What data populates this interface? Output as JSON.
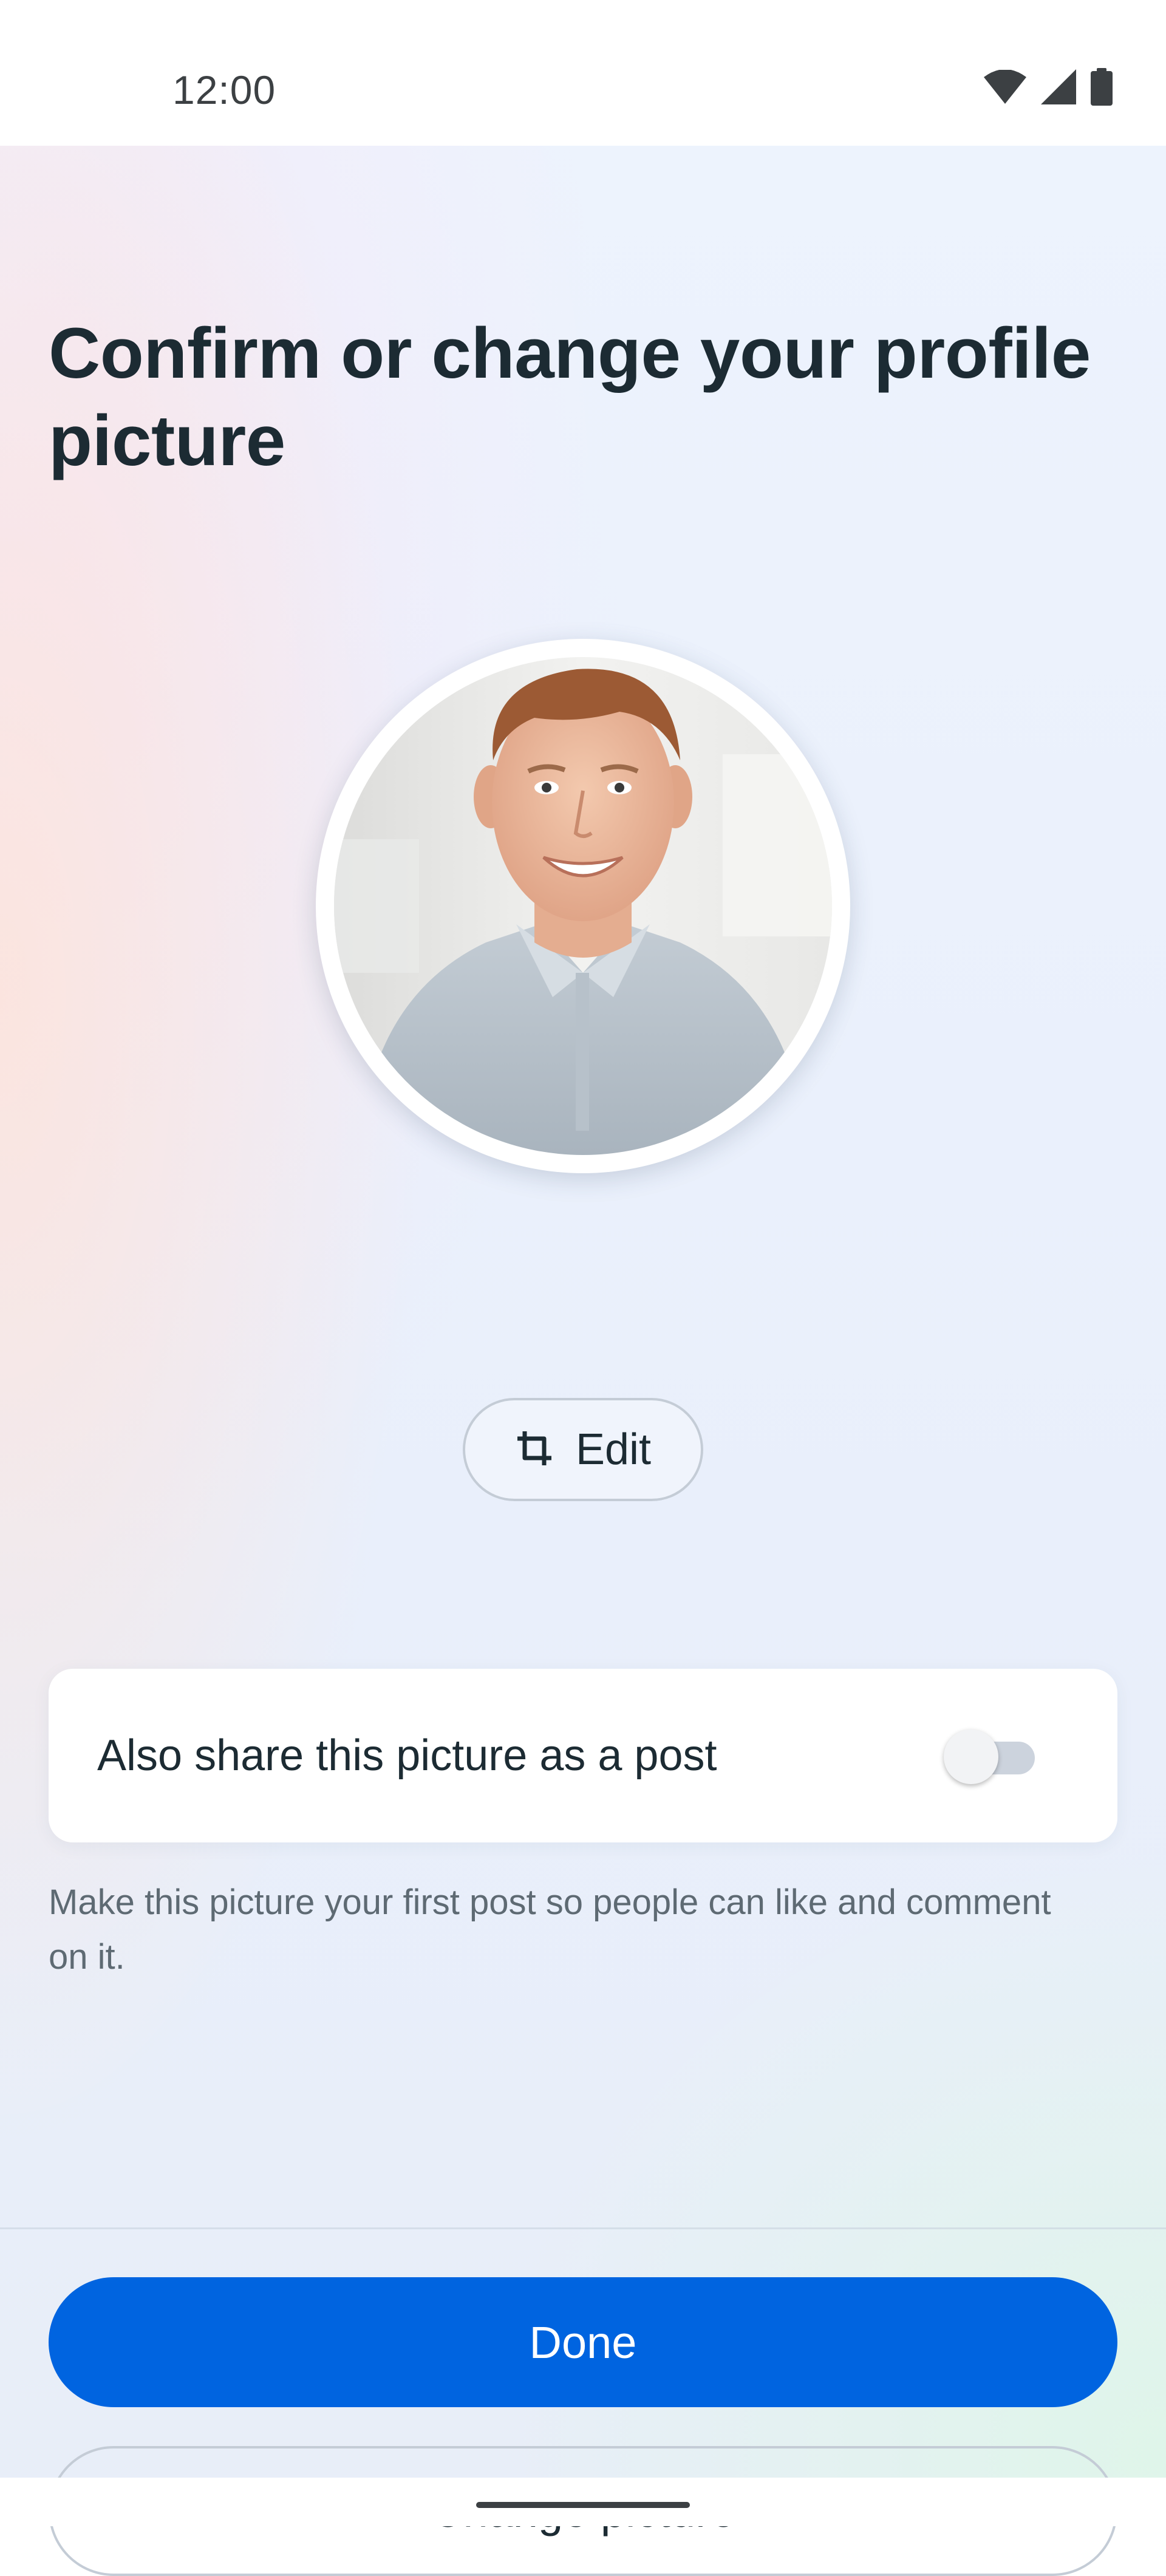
{
  "status_bar": {
    "time": "12:00",
    "icons": [
      "wifi-icon",
      "cellular-signal-icon",
      "battery-icon"
    ]
  },
  "page": {
    "title": "Confirm or change your profile picture"
  },
  "profile_picture": {
    "edit_label": "Edit",
    "edit_icon": "crop-icon"
  },
  "share_option": {
    "label": "Also share this picture as a post",
    "toggle_on": false,
    "helper_text": "Make this picture your first post so people can like and comment on it."
  },
  "actions": {
    "done_label": "Done",
    "change_label": "Change picture"
  },
  "colors": {
    "primary": "#0064e0",
    "text": "#1c2b33",
    "secondary_text": "#5e6a73",
    "outline": "#c4ccd6"
  }
}
